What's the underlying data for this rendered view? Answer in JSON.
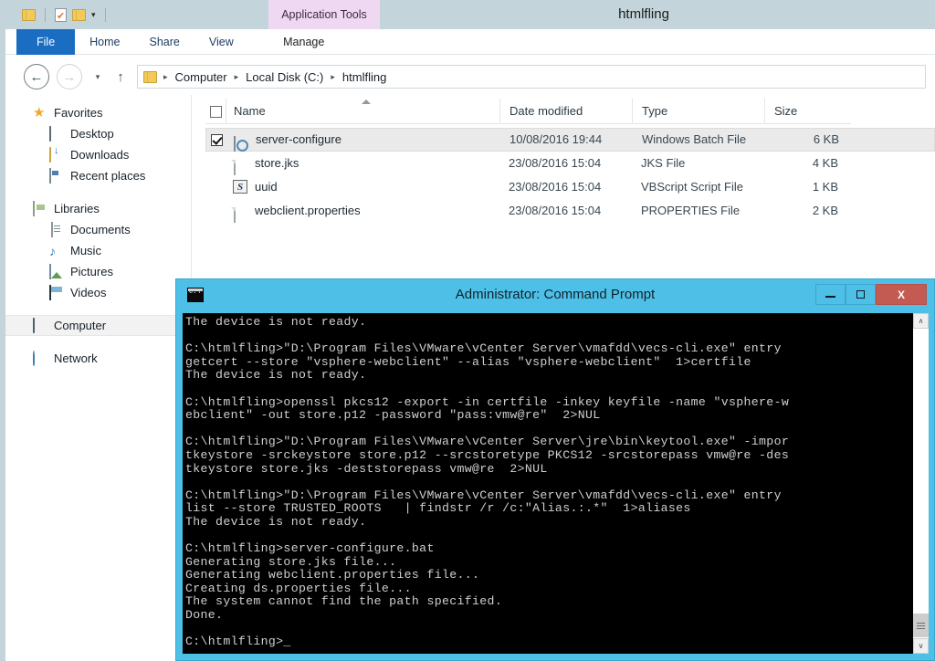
{
  "explorer": {
    "title": "htmlfling",
    "quick_access": [
      {
        "name": "folder-icon",
        "label": ""
      },
      {
        "name": "properties-icon",
        "label": ""
      },
      {
        "name": "new-folder-icon",
        "label": ""
      },
      {
        "name": "chevron-down-icon",
        "label": "▾"
      }
    ],
    "contextual_tab_group": "Application Tools",
    "ribbon_tabs": [
      {
        "label": "File",
        "active": true
      },
      {
        "label": "Home",
        "active": false
      },
      {
        "label": "Share",
        "active": false
      },
      {
        "label": "View",
        "active": false
      },
      {
        "label": "Manage",
        "active": false
      }
    ],
    "address": {
      "back_icon": "←",
      "forward_icon": "→",
      "history_icon": "▾",
      "up_icon": "↑",
      "separator": "▸",
      "crumbs": [
        "Computer",
        "Local Disk (C:)",
        "htmlfling"
      ]
    },
    "navpane": [
      {
        "label": "Favorites",
        "icon": "star-icon",
        "level": 0,
        "selected": false
      },
      {
        "label": "Desktop",
        "icon": "desktop-icon",
        "level": 1,
        "selected": false
      },
      {
        "label": "Downloads",
        "icon": "downloads-folder-icon",
        "level": 1,
        "selected": false
      },
      {
        "label": "Recent places",
        "icon": "recent-places-icon",
        "level": 1,
        "selected": false
      },
      {
        "label": "Libraries",
        "icon": "libraries-icon",
        "level": 0,
        "selected": false,
        "gap_before": true
      },
      {
        "label": "Documents",
        "icon": "documents-icon",
        "level": 1,
        "selected": false
      },
      {
        "label": "Music",
        "icon": "music-icon",
        "level": 1,
        "selected": false
      },
      {
        "label": "Pictures",
        "icon": "pictures-icon",
        "level": 1,
        "selected": false
      },
      {
        "label": "Videos",
        "icon": "videos-icon",
        "level": 1,
        "selected": false
      },
      {
        "label": "Computer",
        "icon": "computer-icon",
        "level": 0,
        "selected": true,
        "gap_before": true
      },
      {
        "label": "Network",
        "icon": "network-icon",
        "level": 0,
        "selected": false,
        "gap_before": true
      }
    ],
    "columns": [
      {
        "key": "name",
        "label": "Name",
        "sorted": true
      },
      {
        "key": "date",
        "label": "Date modified",
        "sorted": false
      },
      {
        "key": "type",
        "label": "Type",
        "sorted": false
      },
      {
        "key": "size",
        "label": "Size",
        "sorted": false
      }
    ],
    "files": [
      {
        "name": "server-configure",
        "date": "10/08/2016 19:44",
        "type": "Windows Batch File",
        "size": "6 KB",
        "icon": "batch-file-icon",
        "checked": true,
        "selected": true
      },
      {
        "name": "store.jks",
        "date": "23/08/2016 15:04",
        "type": "JKS File",
        "size": "4 KB",
        "icon": "generic-file-icon",
        "checked": false,
        "selected": false
      },
      {
        "name": "uuid",
        "date": "23/08/2016 15:04",
        "type": "VBScript Script File",
        "size": "1 KB",
        "icon": "vbscript-file-icon",
        "checked": false,
        "selected": false
      },
      {
        "name": "webclient.properties",
        "date": "23/08/2016 15:04",
        "type": "PROPERTIES File",
        "size": "2 KB",
        "icon": "generic-file-icon",
        "checked": false,
        "selected": false
      }
    ]
  },
  "cmd": {
    "title": "Administrator: Command Prompt",
    "icon_text": "C:\\",
    "buttons": {
      "minimize": "–",
      "maximize": "□",
      "close": "X"
    },
    "scrollbar": {
      "up_arrow": "∧",
      "down_arrow": "∨"
    },
    "console_text": "The device is not ready.\n\nC:\\htmlfling>\"D:\\Program Files\\VMware\\vCenter Server\\vmafdd\\vecs-cli.exe\" entry\ngetcert --store \"vsphere-webclient\" --alias \"vsphere-webclient\"  1>certfile\nThe device is not ready.\n\nC:\\htmlfling>openssl pkcs12 -export -in certfile -inkey keyfile -name \"vsphere-w\nebclient\" -out store.p12 -password \"pass:vmw@re\"  2>NUL\n\nC:\\htmlfling>\"D:\\Program Files\\VMware\\vCenter Server\\jre\\bin\\keytool.exe\" -impor\ntkeystore -srckeystore store.p12 --srcstoretype PKCS12 -srcstorepass vmw@re -des\ntkeystore store.jks -deststorepass vmw@re  2>NUL\n\nC:\\htmlfling>\"D:\\Program Files\\VMware\\vCenter Server\\vmafdd\\vecs-cli.exe\" entry\nlist --store TRUSTED_ROOTS   | findstr /r /c:\"Alias.:.*\"  1>aliases\nThe device is not ready.\n\nC:\\htmlfling>server-configure.bat\nGenerating store.jks file...\nGenerating webclient.properties file...\nCreating ds.properties file...\nThe system cannot find the path specified.\nDone.\n\nC:\\htmlfling>_"
  }
}
